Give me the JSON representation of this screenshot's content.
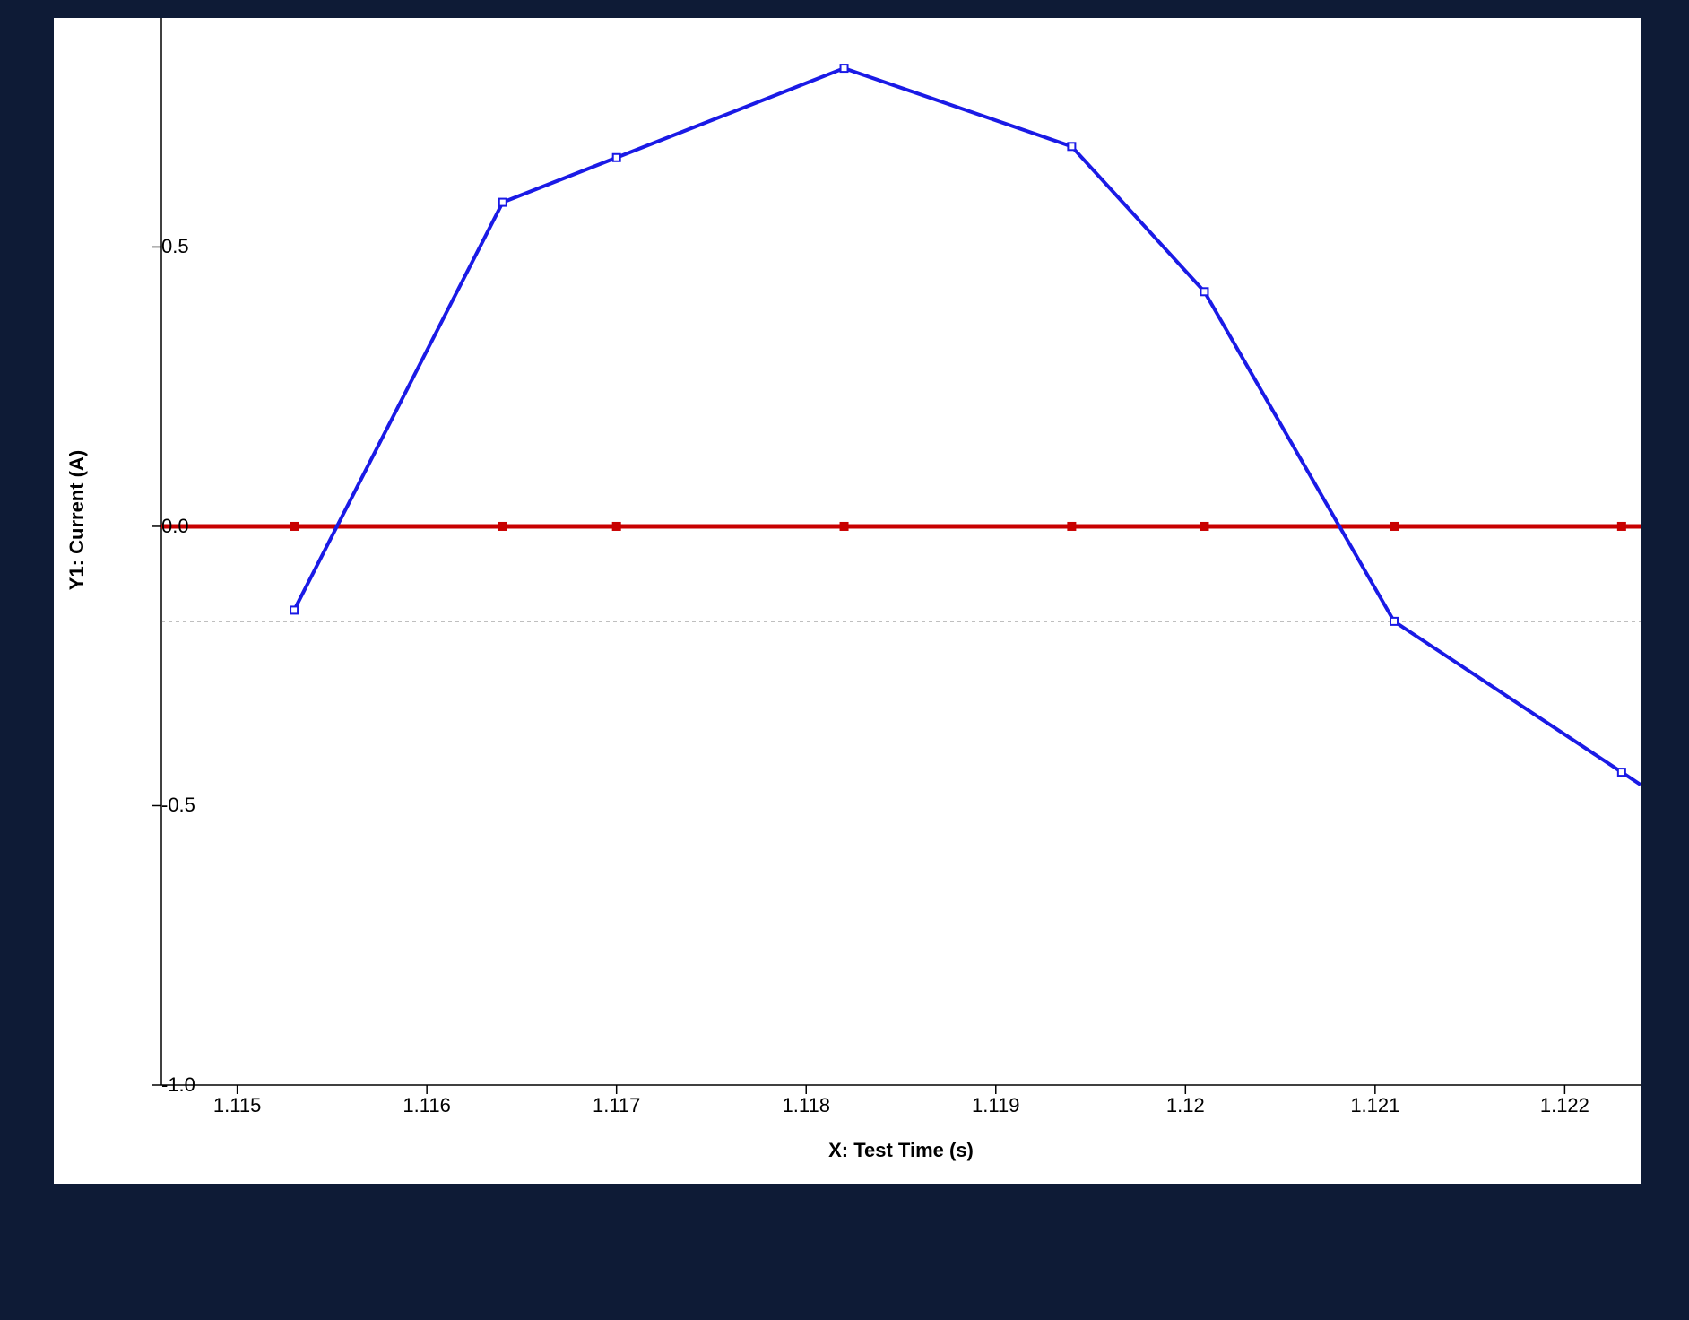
{
  "chart_data": {
    "type": "line",
    "xlabel": "X: Test Time (s)",
    "ylabel": "Y1: Current (A)",
    "xlim": [
      1.1146,
      1.1224
    ],
    "ylim": [
      -1.0,
      0.91
    ],
    "x_ticks": [
      1.115,
      1.116,
      1.117,
      1.118,
      1.119,
      1.12,
      1.121,
      1.122
    ],
    "y_ticks": [
      -1.0,
      -0.5,
      0.0,
      0.5
    ],
    "reference_lines_y": [
      0.0,
      -0.17
    ],
    "series": [
      {
        "name": "blue",
        "color": "#1a1ae6",
        "x": [
          1.1153,
          1.1164,
          1.117,
          1.1182,
          1.1194,
          1.1201,
          1.1211,
          1.1223
        ],
        "y": [
          -0.15,
          0.58,
          0.66,
          0.82,
          0.68,
          0.42,
          -0.17,
          -0.44
        ]
      },
      {
        "name": "red",
        "color": "#c80000",
        "x": [
          1.1153,
          1.1164,
          1.117,
          1.1182,
          1.1194,
          1.1201,
          1.1211,
          1.1223
        ],
        "y": [
          0.0,
          0.0,
          0.0,
          0.0,
          0.0,
          0.0,
          0.0,
          0.0
        ]
      }
    ]
  },
  "labels": {
    "y_ticks": {
      "t0": "-1.0",
      "t1": "-0.5",
      "t2": "0.0",
      "t3": "0.5"
    },
    "x_ticks": {
      "t0": "1.115",
      "t1": "1.116",
      "t2": "1.117",
      "t3": "1.118",
      "t4": "1.119",
      "t5": "1.12",
      "t6": "1.121",
      "t7": "1.122"
    },
    "ylabel": "Y1: Current (A)",
    "xlabel": "X: Test Time (s)"
  }
}
